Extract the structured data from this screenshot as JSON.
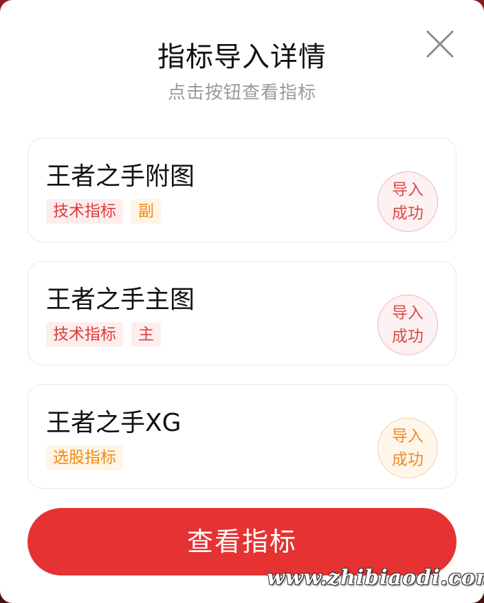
{
  "dialog": {
    "title": "指标导入详情",
    "subtitle": "点击按钮查看指标",
    "close_icon": "close-icon"
  },
  "items": [
    {
      "name": "王者之手附图",
      "tags": [
        {
          "text": "技术指标",
          "color": "#e33b3b"
        },
        {
          "text": "副",
          "color": "#ee8a1a"
        }
      ],
      "status_line1": "导入",
      "status_line2": "成功",
      "status_color": "#d94a4a"
    },
    {
      "name": "王者之手主图",
      "tags": [
        {
          "text": "技术指标",
          "color": "#e33b3b"
        },
        {
          "text": "主",
          "color": "#e33b3b"
        }
      ],
      "status_line1": "导入",
      "status_line2": "成功",
      "status_color": "#d94a4a"
    },
    {
      "name": "王者之手XG",
      "tags": [
        {
          "text": "选股指标",
          "color": "#ee8a1a"
        }
      ],
      "status_line1": "导入",
      "status_line2": "成功",
      "status_color": "#ea8d2c"
    }
  ],
  "actions": {
    "view_label": "查看指标",
    "accent_color": "#e63232"
  },
  "watermark": "www.zhibiaodi.com"
}
